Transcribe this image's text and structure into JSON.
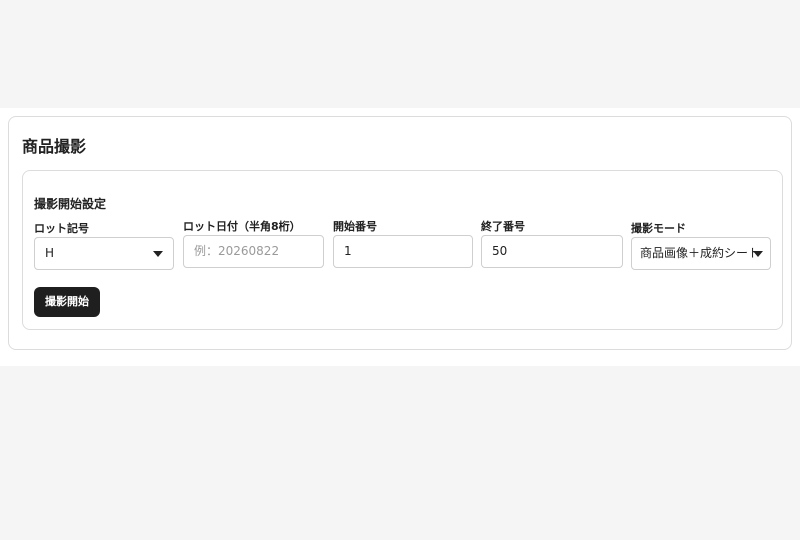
{
  "page": {
    "title": "商品撮影"
  },
  "settings": {
    "title": "撮影開始設定",
    "lot_symbol": {
      "label": "ロット記号",
      "value": "H"
    },
    "lot_date": {
      "label": "ロット日付（半角8桁）",
      "placeholder": "例：20260822",
      "value": ""
    },
    "start_number": {
      "label": "開始番号",
      "value": "1"
    },
    "end_number": {
      "label": "終了番号",
      "value": "50"
    },
    "shoot_mode": {
      "label": "撮影モード",
      "value": "商品画像＋成約シート"
    },
    "start_button": "撮影開始"
  },
  "icons": {
    "dropdown": "caret-down-icon"
  }
}
